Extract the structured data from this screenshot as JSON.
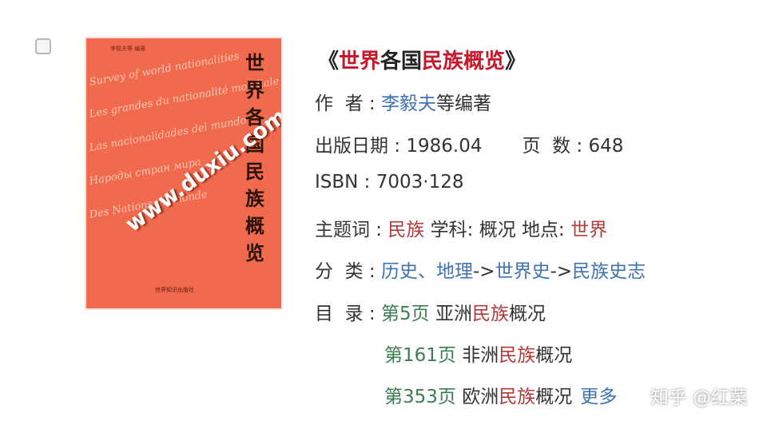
{
  "book": {
    "title_open": "《",
    "title_part1": "世界",
    "title_part2": "各国",
    "title_part3": "民族概览",
    "title_close": "》",
    "author_label": "作  者 : ",
    "author_name": "李毅夫",
    "author_suffix": "等编著",
    "date_label": "出版日期 : ",
    "date_value": "1986.04",
    "pages_label": "页  数 : ",
    "pages_value": "648",
    "isbn_label": "ISBN : ",
    "isbn_value": "7003·128",
    "subject_label": "主题词 : ",
    "subject_value": "民族",
    "discipline_label": " 学科: ",
    "discipline_value": "概况",
    "place_label": " 地点: ",
    "place_value": "世界",
    "category_label": "分  类 : ",
    "category_1": "历史、地理",
    "arrow_1": "->",
    "category_2": "世界史",
    "arrow_2": "->",
    "category_3": "民族史志",
    "toc_label": "目  录 : ",
    "toc": [
      {
        "page": "第5页",
        "pre": " 亚洲",
        "hl": "民族",
        "post": "概况"
      },
      {
        "page": "第161页",
        "pre": " 非洲",
        "hl": "民族",
        "post": "概况"
      },
      {
        "page": "第353页",
        "pre": " 欧洲",
        "hl": "民族",
        "post": "概况"
      }
    ],
    "more_label": "更多"
  },
  "cover": {
    "title": "世界各国民族概览",
    "watermark": "www.duxiu.com",
    "script_lines": [
      "Survey of world nationalities",
      "Les grandes du nationalité mondiale",
      "Las nacionalidades del mundo",
      "Народы стран мира",
      "Des Nations du monde"
    ]
  },
  "watermark": "知乎 @红菜"
}
